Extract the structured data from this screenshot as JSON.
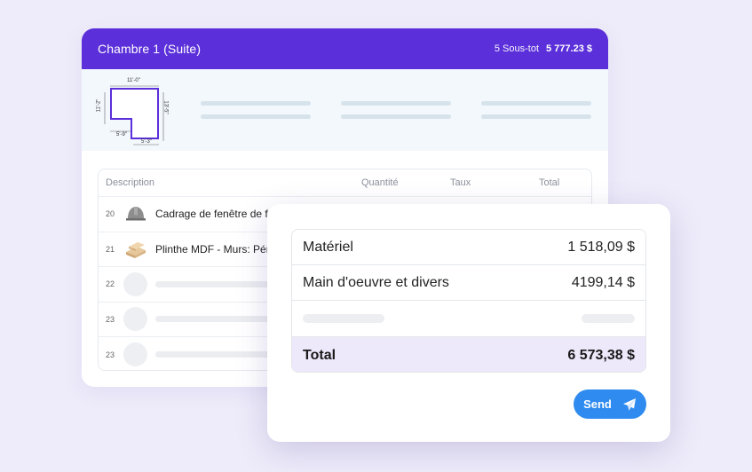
{
  "header": {
    "room_title": "Chambre 1 (Suite)",
    "subtotal_label": "5 Sous-tot",
    "subtotal_value": "5 777.23 $"
  },
  "floor_plan": {
    "dim_top": "11'-0\"",
    "dim_left": "11'-2\"",
    "dim_right": "13'-5\"",
    "dim_bottom_inner": "5'-9\"",
    "dim_bottom_outer": "5'-3\""
  },
  "table": {
    "columns": [
      "Description",
      "Quantité",
      "Taux",
      "Total"
    ],
    "rows": [
      {
        "num": "20",
        "icon": "hard-hat-icon",
        "description": "Cadrage de fenêtre de f"
      },
      {
        "num": "21",
        "icon": "wood-planks-icon",
        "description": "Plinthe MDF - Murs: Pér"
      },
      {
        "num": "22",
        "icon": "placeholder",
        "description": ""
      },
      {
        "num": "23",
        "icon": "placeholder",
        "description": ""
      },
      {
        "num": "23",
        "icon": "placeholder",
        "description": ""
      }
    ]
  },
  "summary": {
    "rows": [
      {
        "label": "Matériel",
        "value": "1 518,09 $"
      },
      {
        "label": "Main d'oeuvre et divers",
        "value": "4199,14 $"
      }
    ],
    "total_label": "Total",
    "total_value": "6 573,38 $"
  },
  "send_button": {
    "label": "Send",
    "icon": "paper-plane-icon"
  },
  "colors": {
    "header_purple": "#5b2fd9",
    "send_blue": "#2f8bf0",
    "total_row_bg": "#ede8fa",
    "page_bg": "#eeecfa"
  }
}
